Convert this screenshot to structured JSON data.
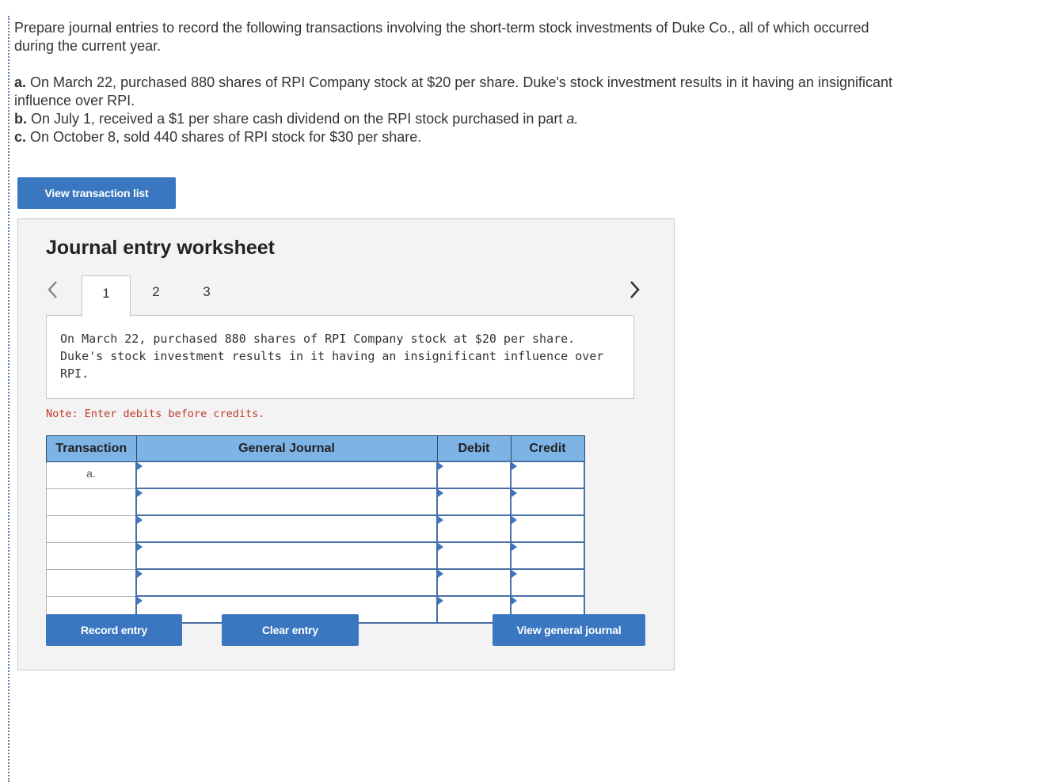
{
  "prompt": {
    "intro": "Prepare journal entries to record the following transactions involving the short-term stock investments of Duke Co., all of which occurred during the current year.",
    "items": [
      {
        "label": "a.",
        "text": " On March 22, purchased 880 shares of RPI Company stock at $20 per share. Duke's stock investment results in it having an insignificant influence over RPI."
      },
      {
        "label": "b.",
        "text": " On July 1, received a $1 per share cash dividend on the RPI stock purchased in part ",
        "emph": "a."
      },
      {
        "label": "c.",
        "text": " On October 8, sold 440 shares of RPI stock for $30 per share."
      }
    ]
  },
  "buttons": {
    "view_transaction_list": "View transaction list",
    "record_entry": "Record entry",
    "clear_entry": "Clear entry",
    "view_general_journal": "View general journal"
  },
  "worksheet": {
    "title": "Journal entry worksheet",
    "tabs": [
      "1",
      "2",
      "3"
    ],
    "active_tab": "1",
    "description_line1": "On March 22, purchased 880 shares of RPI Company stock at $20 per share.",
    "description_line2": "Duke's stock investment results in it having an insignificant influence over RPI.",
    "note": "Note: Enter debits before credits."
  },
  "table": {
    "headers": {
      "transaction": "Transaction",
      "general_journal": "General Journal",
      "debit": "Debit",
      "credit": "Credit"
    },
    "rows": [
      {
        "transaction": "a.",
        "general_journal": "",
        "debit": "",
        "credit": ""
      },
      {
        "transaction": "",
        "general_journal": "",
        "debit": "",
        "credit": ""
      },
      {
        "transaction": "",
        "general_journal": "",
        "debit": "",
        "credit": ""
      },
      {
        "transaction": "",
        "general_journal": "",
        "debit": "",
        "credit": ""
      },
      {
        "transaction": "",
        "general_journal": "",
        "debit": "",
        "credit": ""
      },
      {
        "transaction": "",
        "general_journal": "",
        "debit": "",
        "credit": ""
      }
    ]
  },
  "colors": {
    "accent": "#3a77c0",
    "header_bg": "#7eb3e6",
    "note": "#c0392b"
  }
}
